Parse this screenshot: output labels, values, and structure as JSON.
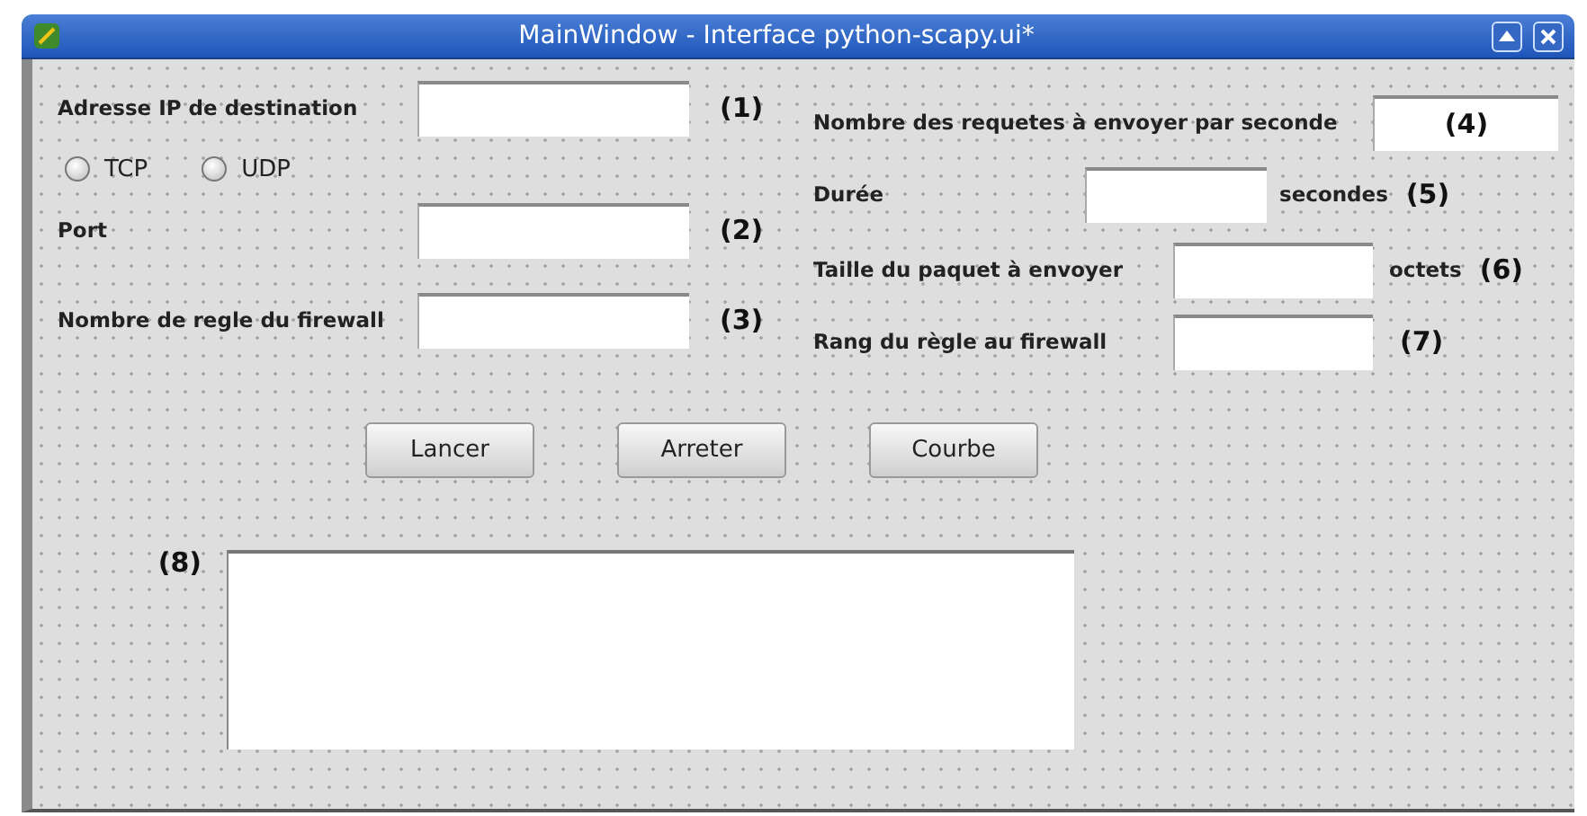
{
  "window": {
    "title": "MainWindow - Interface python-scapy.ui*"
  },
  "left_fields": [
    {
      "label": "Adresse IP de destination",
      "marker": "(1)"
    },
    {
      "label": "Port",
      "marker": "(2)"
    },
    {
      "label": "Nombre de regle du firewall",
      "marker": "(3)"
    }
  ],
  "radios": [
    {
      "label": "TCP",
      "selected": false
    },
    {
      "label": "UDP",
      "selected": false
    }
  ],
  "right_fields": [
    {
      "kind": "marker-inside",
      "label": "Nombre des  requetes à envoyer par seconde",
      "marker": "(4)"
    },
    {
      "kind": "unit",
      "label": "Durée",
      "unit": "secondes",
      "marker": "(5)"
    },
    {
      "kind": "unit",
      "label": "Taille du paquet à envoyer",
      "unit": "octets",
      "marker": "(6)"
    },
    {
      "kind": "plain",
      "label": "Rang du règle au firewall",
      "marker": "(7)"
    }
  ],
  "buttons": [
    "Lancer",
    "Arreter",
    "Courbe"
  ],
  "output": {
    "marker": "(8)"
  }
}
